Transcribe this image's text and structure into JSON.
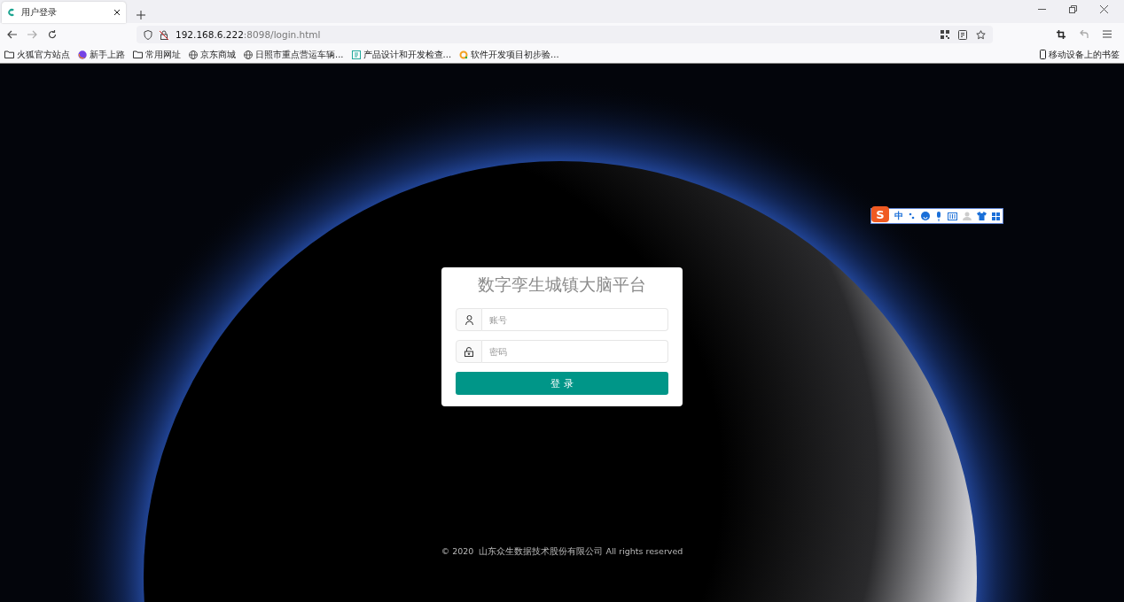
{
  "tab": {
    "title": "用户登录",
    "selected": true
  },
  "address": {
    "host": "192.168.6.222",
    "rest": ":8098/login.html"
  },
  "bookmarks": [
    {
      "kind": "folder",
      "label": "火狐官方站点"
    },
    {
      "kind": "browser",
      "label": "新手上路"
    },
    {
      "kind": "folder",
      "label": "常用网址"
    },
    {
      "kind": "globe",
      "label": "京东商城"
    },
    {
      "kind": "globe",
      "label": "日照市重点营运车辆..."
    },
    {
      "kind": "sheet",
      "label": "产品设计和开发检查..."
    },
    {
      "kind": "ring",
      "label": "软件开发项目初步验..."
    }
  ],
  "mobile_bookmarks": "移动设备上的书签",
  "ime_toolbar": {
    "logo": "S",
    "mode": "中"
  },
  "login": {
    "title": "数字孪生城镇大脑平台",
    "account_placeholder": "账号",
    "password_placeholder": "密码",
    "submit": "登 录"
  },
  "footer": "© 2020  山东众生数据技术股份有限公司 All rights reserved"
}
